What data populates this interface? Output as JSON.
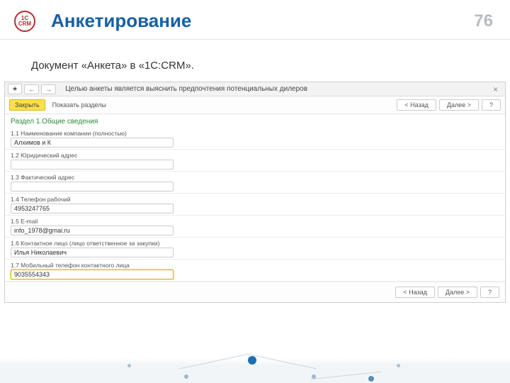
{
  "slide": {
    "title": "Анкетирование",
    "page": "76",
    "logo_top": "1С",
    "logo_bottom": "CRM"
  },
  "subtitle": "Документ «Анкета» в «1С:CRM».",
  "app": {
    "star": "★",
    "back": "←",
    "fwd": "→",
    "title": "Целью анкеты является выяснить предпочтения потенциальных дилеров",
    "close_x": "×",
    "close_btn": "Закрыть",
    "show_sections": "Показать разделы",
    "prev": "< Назад",
    "next": "Далее >",
    "help": "?",
    "section": "Раздел 1.Общие сведения",
    "fields": [
      {
        "label": "1.1 Наименование компании (полностью)",
        "value": "Алхимов и К"
      },
      {
        "label": "1.2 Юридический адрес",
        "value": ""
      },
      {
        "label": "1.3 Фактический адрес",
        "value": ""
      },
      {
        "label": "1.4 Телефон рабочий",
        "value": "4953247765"
      },
      {
        "label": "1.5 E-mail",
        "value": "info_1978@gmai.ru"
      },
      {
        "label": "1.6 Контактное лицо (лицо ответственное за закупки)",
        "value": "Илья Николаевич"
      },
      {
        "label": "1.7 Мобильный телефон контактного лица",
        "value": "9035554343"
      }
    ]
  }
}
